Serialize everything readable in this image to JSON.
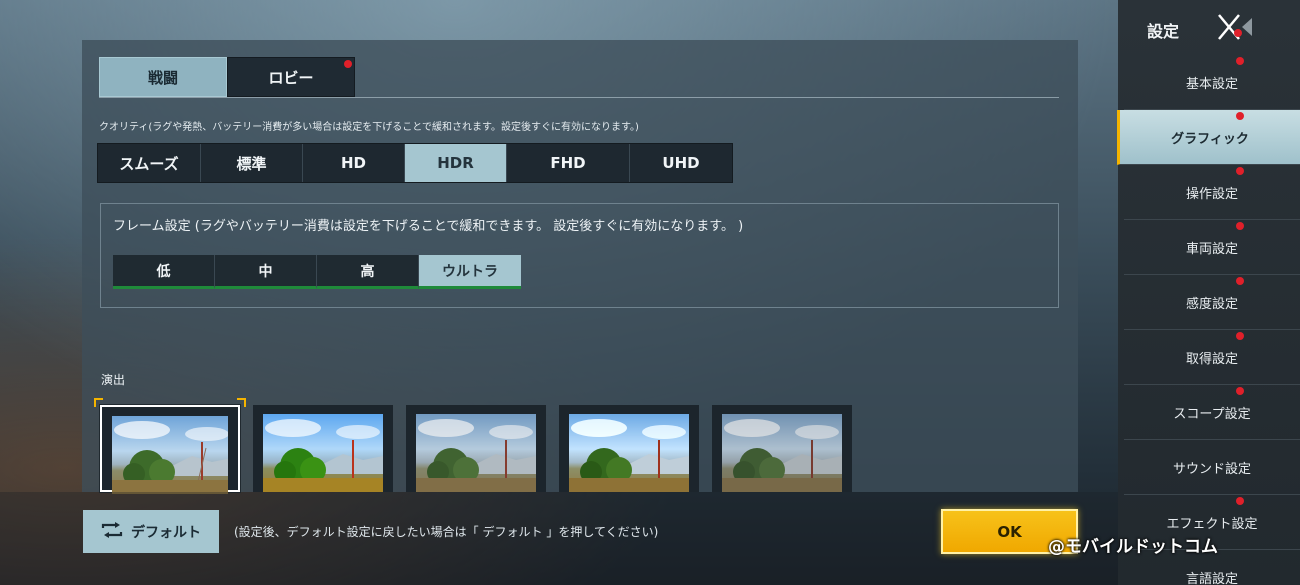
{
  "tabs": [
    {
      "label": "戦闘",
      "active": true
    },
    {
      "label": "ロビー",
      "active": false,
      "badge": true
    }
  ],
  "quality": {
    "note": "クオリティ(ラグや発熱、バッテリー消費が多い場合は設定を下げることで緩和されます。設定後すぐに有効になります。)",
    "options": [
      "スムーズ",
      "標準",
      "HD",
      "HDR",
      "FHD",
      "UHD"
    ],
    "selected": "HDR"
  },
  "frame": {
    "note": "フレーム設定 (ラグやバッテリー消費は設定を下げることで緩和できます。 設定後すぐに有効になります。 )",
    "options": [
      "低",
      "中",
      "高",
      "ウルトラ"
    ],
    "selected": "ウルトラ"
  },
  "effects": {
    "label": "演出",
    "thumbnail_count": 5,
    "selected_index": 0
  },
  "footer": {
    "default_label": "デフォルト",
    "default_note": "(設定後、デフォルト設定に戻したい場合は「 デフォルト 」を押してください)",
    "ok_label": "OK"
  },
  "watermark": "@モバイルドットコム",
  "sidebar": {
    "title": "設定",
    "items": [
      {
        "label": "基本設定",
        "active": false
      },
      {
        "label": "グラフィック",
        "active": true
      },
      {
        "label": "操作設定",
        "active": false
      },
      {
        "label": "車両設定",
        "active": false
      },
      {
        "label": "感度設定",
        "active": false
      },
      {
        "label": "取得設定",
        "active": false
      },
      {
        "label": "スコープ設定",
        "active": false
      },
      {
        "label": "サウンド設定",
        "active": false
      },
      {
        "label": "エフェクト設定",
        "active": false
      },
      {
        "label": "言語設定",
        "active": false
      }
    ]
  },
  "colors": {
    "accent": "#a5c6d0",
    "ok": "#f5b400",
    "badge": "#e0202a",
    "frame_underline": "#1f8a3a"
  }
}
